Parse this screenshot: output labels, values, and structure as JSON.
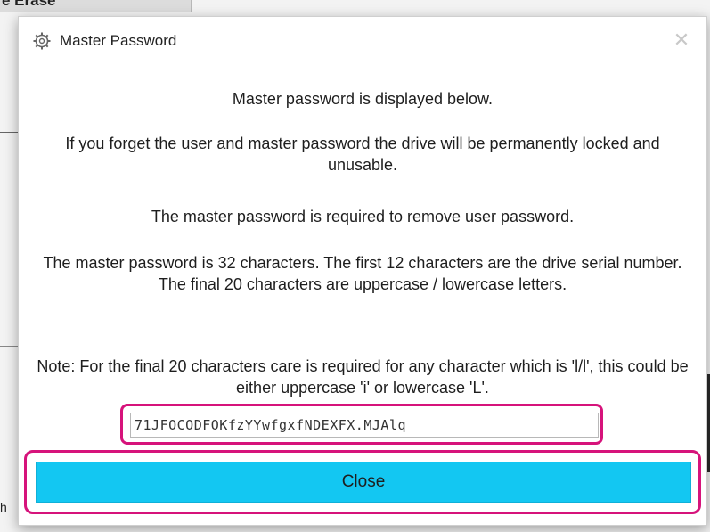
{
  "background": {
    "tab_label": "e Erase",
    "edge_text": "h"
  },
  "dialog": {
    "title": "Master Password",
    "title_icon": "gear-icon",
    "close_glyph": "✕",
    "messages": [
      "Master password is displayed below.",
      "If you forget the user and master password the drive will be permanently locked and unusable.",
      "The master password is required to remove user password.",
      "The master password is 32 characters. The first 12 characters are the drive serial number. The final 20 characters are uppercase / lowercase letters.",
      "Note: For the final 20 characters care is required for any character which is 'l/l', this could be either uppercase 'i' or lowercase 'L'."
    ],
    "password_value": "71JFOCODFOKfzYYwfgxfNDEXFX.MJAlq",
    "close_button_label": "Close",
    "accent_color": "#13c7f2",
    "highlight_color": "#d6137b"
  }
}
